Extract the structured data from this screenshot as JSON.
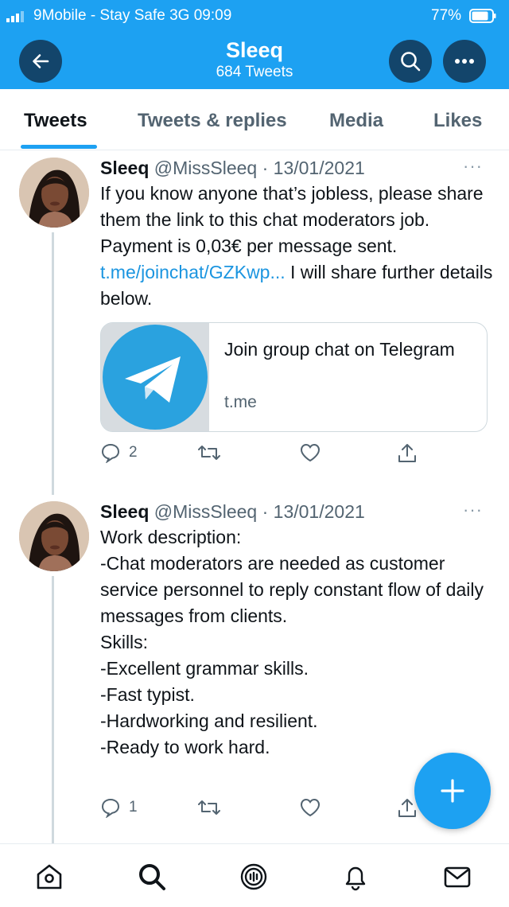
{
  "status_bar": {
    "carrier": "9Mobile - Stay Safe  3G  09:09",
    "battery": "77%"
  },
  "header": {
    "title": "Sleeq",
    "subtitle": "684 Tweets",
    "icons": [
      "arrow-left-icon",
      "search-icon",
      "more-icon"
    ]
  },
  "tabs": [
    {
      "label": "Tweets",
      "active": true
    },
    {
      "label": "Tweets & replies",
      "active": false
    },
    {
      "label": "Media",
      "active": false
    },
    {
      "label": "Likes",
      "active": false
    }
  ],
  "tweets": [
    {
      "name": "Sleeq",
      "handle": "@MissSleeq",
      "date": "· 13/01/2021",
      "more": "···",
      "text_before_link": "If you know anyone that’s jobless, please share them the link to this chat moderators job. Payment is 0,03€ per message sent. ",
      "link": "t.me/joinchat/GZKwp...",
      "text_after_link": " I will share further details below.",
      "card": {
        "title": "Join group chat on Telegram",
        "domain": "t.me"
      },
      "replies": "2"
    },
    {
      "name": "Sleeq",
      "handle": "@MissSleeq",
      "date": "· 13/01/2021",
      "more": "···",
      "text": "Work description:\n-Chat moderators are needed as customer service personnel to reply constant flow of daily messages from clients.\nSkills:\n-Excellent grammar skills.\n-Fast typist.\n-Hardworking and resilient.\n-Ready to work hard.",
      "replies": "1"
    }
  ],
  "bottom_nav": [
    "home-icon",
    "search-icon",
    "spaces-icon",
    "notifications-icon",
    "messages-icon"
  ],
  "colors": {
    "accent": "#1da1f2",
    "header_button": "#13456b",
    "link": "#1b95e0",
    "telegram": "#2aa2df"
  }
}
